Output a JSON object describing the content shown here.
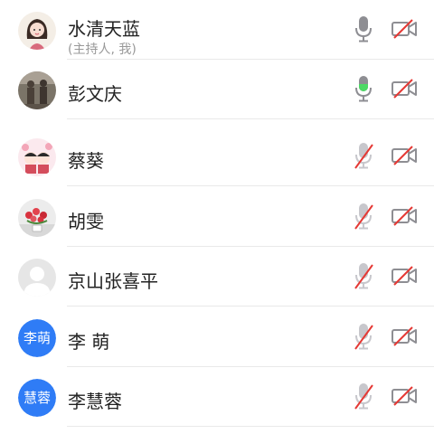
{
  "participants": [
    {
      "name": "水清天蓝",
      "subtitle": "(主持人, 我)",
      "avatar": "photo",
      "mic": "idle",
      "camera": "off"
    },
    {
      "name": "彭文庆",
      "subtitle": "",
      "avatar": "photo",
      "mic": "speaking",
      "camera": "off"
    },
    {
      "name": "蔡葵",
      "subtitle": "",
      "avatar": "photo",
      "mic": "muted",
      "camera": "off"
    },
    {
      "name": "胡雯",
      "subtitle": "",
      "avatar": "photo",
      "mic": "muted",
      "camera": "off"
    },
    {
      "name": "京山张喜平",
      "subtitle": "",
      "avatar": "default",
      "mic": "muted",
      "camera": "off"
    },
    {
      "name": "李 萌",
      "subtitle": "",
      "avatar_text": "李萌",
      "mic": "muted",
      "camera": "off"
    },
    {
      "name": "李慧蓉",
      "subtitle": "",
      "avatar_text": "慧蓉",
      "mic": "muted",
      "camera": "off"
    }
  ],
  "colors": {
    "accent_blue": "#2f7cf6",
    "speaking_green": "#4cd964",
    "muted_red": "#e53935",
    "icon_gray": "#8e8e93"
  },
  "icons": {
    "mic": "microphone-icon",
    "mic_muted": "microphone-muted-icon",
    "camera_off": "camera-off-icon"
  }
}
